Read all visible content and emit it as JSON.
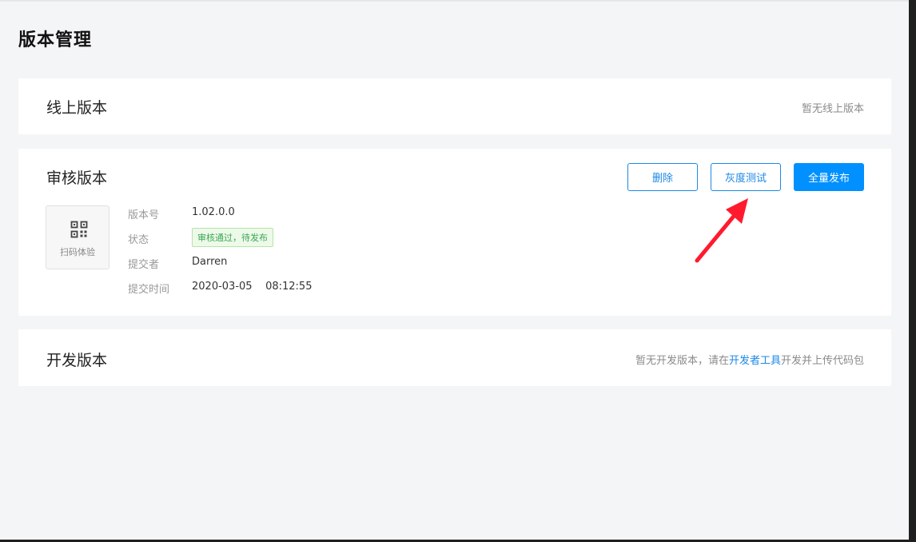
{
  "page": {
    "title": "版本管理"
  },
  "online": {
    "title": "线上版本",
    "empty_note": "暂无线上版本"
  },
  "review": {
    "title": "审核版本",
    "buttons": {
      "delete": "删除",
      "gray_test": "灰度测试",
      "full_release": "全量发布"
    },
    "qr": {
      "label": "扫码体验",
      "icon": "qrcode-icon"
    },
    "info": [
      {
        "label": "版本号",
        "value": "1.02.0.0"
      },
      {
        "label": "状态",
        "value": "审核通过，待发布"
      },
      {
        "label": "提交者",
        "value": "Darren"
      },
      {
        "label": "提交时间",
        "value": "2020-03-05    08:12:55"
      }
    ]
  },
  "dev": {
    "title": "开发版本",
    "note_prefix": "暂无开发版本，请在",
    "note_link": "开发者工具",
    "note_suffix": "开发并上传代码包"
  },
  "colors": {
    "accent": "#1e88e5",
    "primary_button": "#0090ff",
    "arrow": "#ff1a2e",
    "status_green": "#3aa655"
  }
}
